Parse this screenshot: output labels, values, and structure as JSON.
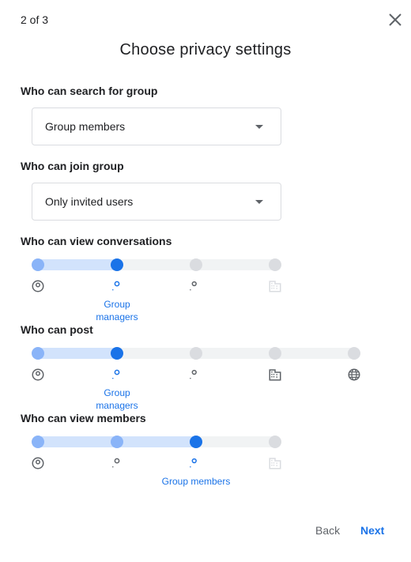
{
  "header": {
    "step": "2 of 3",
    "title": "Choose privacy settings"
  },
  "search": {
    "label": "Who can search for group",
    "value": "Group members"
  },
  "join": {
    "label": "Who can join group",
    "value": "Only invited users"
  },
  "conversations": {
    "label": "Who can view conversations",
    "levels": [
      "person-circle-icon",
      "person-icon",
      "people-icon",
      "building-icon"
    ],
    "selected": 1,
    "caption": "Group managers"
  },
  "post": {
    "label": "Who can post",
    "levels": [
      "person-circle-icon",
      "person-icon",
      "people-icon",
      "building-icon",
      "globe-icon"
    ],
    "selected": 1,
    "caption": "Group managers"
  },
  "members": {
    "label": "Who can view members",
    "levels": [
      "person-circle-icon",
      "person-icon",
      "people-icon",
      "building-icon"
    ],
    "selected": 2,
    "caption": "Group members"
  },
  "footer": {
    "back": "Back",
    "next": "Next"
  },
  "colors": {
    "accent": "#1a73e8",
    "track_fill": "#d2e3fc",
    "track": "#f1f3f4",
    "disabled": "#dadce0"
  }
}
